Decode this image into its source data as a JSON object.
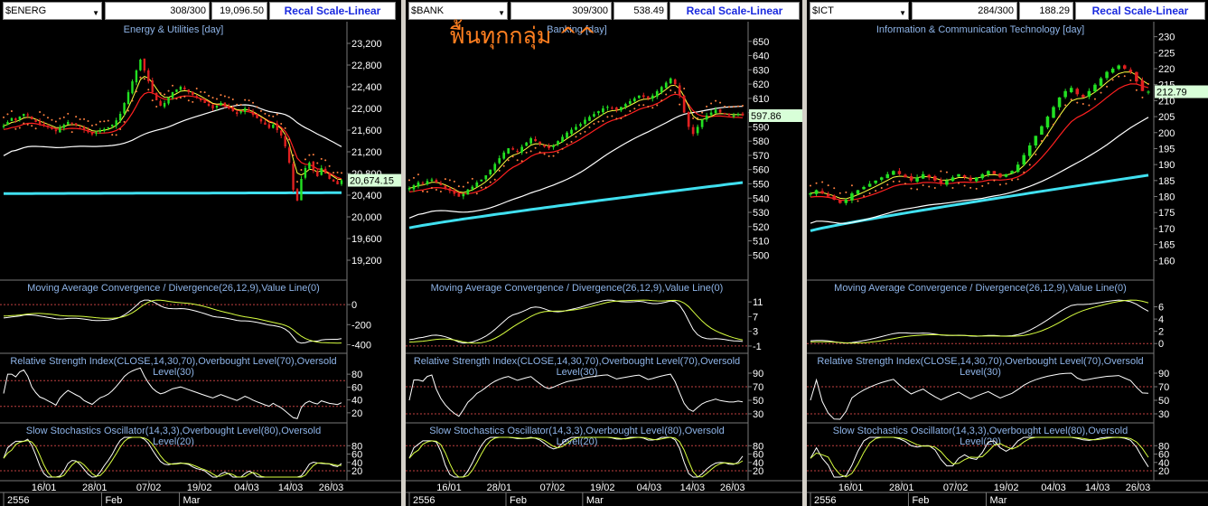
{
  "annotation": "ฟื้นทุกกลุ่ม ^^",
  "recal_label": "Recal Scale-Linear",
  "colors": {
    "bull": "#22e022",
    "bear": "#e02020",
    "ma_fast": "#ffff40",
    "ma_mid": "#ff2020",
    "ma_slow": "#ffffff",
    "ma_long": "#40e0f0",
    "sar": "#ff8040",
    "panel_bg": "#000000",
    "grid": "#777777",
    "title": "#8eb4e8",
    "level": "#c04040"
  },
  "panels": [
    {
      "symbol": "$ENERG",
      "count": "308/300",
      "value": "19,096.50",
      "main": {
        "title": "Energy & Utilities [day]",
        "min": 18900,
        "max": 23500,
        "ticks": [
          "23,200",
          "22,800",
          "22,400",
          "22,000",
          "21,600",
          "21,200",
          "20,800",
          "20,400",
          "20,000",
          "19,600",
          "19,200"
        ],
        "tick_values": [
          23200,
          22800,
          22400,
          22000,
          21600,
          21200,
          20800,
          20400,
          20000,
          19600,
          19200
        ],
        "last": "20,674.15",
        "last_value": 20674.15,
        "closes": [
          21680,
          21750,
          21820,
          21780,
          21850,
          21900,
          21870,
          21800,
          21750,
          21700,
          21680,
          21650,
          21620,
          21580,
          21650,
          21700,
          21750,
          21720,
          21690,
          21660,
          21600,
          21560,
          21520,
          21560,
          21600,
          21620,
          21650,
          21700,
          21780,
          21900,
          22100,
          22300,
          22500,
          22700,
          22900,
          22700,
          22500,
          22300,
          22150,
          22050,
          22100,
          22200,
          22300,
          22350,
          22400,
          22350,
          22300,
          22250,
          22200,
          22150,
          22100,
          22050,
          22000,
          22050,
          22100,
          22050,
          22000,
          21950,
          21900,
          21950,
          22000,
          21950,
          21880,
          21820,
          21760,
          21700,
          21640,
          21700,
          21600,
          21500,
          21300,
          21000,
          20500,
          20300,
          20700,
          20900,
          21000,
          20850,
          20750,
          20900,
          20800,
          20700,
          20650,
          20600,
          20674
        ]
      },
      "macd": {
        "title": "Moving Average Convergence / Divergence(26,12,9),Value Line(0)",
        "min": -450,
        "max": 100,
        "ticks": [
          "0",
          "-200",
          "-400"
        ],
        "tick_values": [
          0,
          -200,
          -400
        ],
        "levels": [
          0
        ]
      },
      "rsi": {
        "title": "Relative Strength Index(CLOSE,14,30,70),Overbought Level(70),Oversold Level(30)",
        "min": 10,
        "max": 90,
        "ticks": [
          "80",
          "60",
          "40",
          "20"
        ],
        "tick_values": [
          80,
          60,
          40,
          20
        ],
        "levels": [
          70,
          30
        ]
      },
      "sto": {
        "title": "Slow Stochastics Oscillator(14,3,3),Overbought Level(80),Oversold Level(20)",
        "min": 5,
        "max": 100,
        "ticks": [
          "80",
          "60",
          "40",
          "20"
        ],
        "tick_values": [
          80,
          60,
          40,
          20
        ],
        "levels": [
          80,
          20
        ]
      },
      "dates": [
        "16/01",
        "28/01",
        "07/02",
        "19/02",
        "04/03",
        "14/03",
        "26/03"
      ],
      "bottom": [
        "2556",
        "Feb",
        "Mar"
      ]
    },
    {
      "symbol": "$BANK",
      "count": "309/300",
      "value": "538.49",
      "main": {
        "title": "Banking [day]",
        "min": 485,
        "max": 660,
        "ticks": [
          "650",
          "640",
          "630",
          "620",
          "610",
          "600",
          "590",
          "580",
          "570",
          "560",
          "550",
          "540",
          "530",
          "520",
          "510",
          "500"
        ],
        "tick_values": [
          650,
          640,
          630,
          620,
          610,
          600,
          590,
          580,
          570,
          560,
          550,
          540,
          530,
          520,
          510,
          500
        ],
        "last": "597.86",
        "last_value": 597.86,
        "closes": [
          547,
          549,
          551,
          550,
          552,
          553,
          551,
          549,
          547,
          545,
          543,
          541,
          543,
          546,
          548,
          551,
          553,
          556,
          560,
          564,
          568,
          572,
          575,
          574,
          573,
          576,
          579,
          582,
          580,
          578,
          576,
          575,
          577,
          580,
          583,
          586,
          588,
          590,
          592,
          595,
          597,
          599,
          601,
          603,
          604,
          603,
          602,
          604,
          606,
          608,
          610,
          612,
          611,
          610,
          612,
          615,
          618,
          621,
          624,
          620,
          612,
          600,
          590,
          585,
          590,
          595,
          598,
          600,
          602,
          600,
          599,
          598,
          598,
          599,
          598
        ]
      },
      "macd": {
        "title": "Moving Average Convergence / Divergence(26,12,9),Value Line(0)",
        "min": -2,
        "max": 13,
        "ticks": [
          "11",
          "7",
          "3",
          "-1"
        ],
        "tick_values": [
          11,
          7,
          3,
          -1
        ],
        "levels": [
          -1
        ]
      },
      "rsi": {
        "title": "Relative Strength Index(CLOSE,14,30,70),Overbought Level(70),Oversold Level(30)",
        "min": 22,
        "max": 98,
        "ticks": [
          "90",
          "70",
          "50",
          "30"
        ],
        "tick_values": [
          90,
          70,
          50,
          30
        ],
        "levels": [
          70,
          30
        ]
      },
      "sto": {
        "title": "Slow Stochastics Oscillator(14,3,3),Overbought Level(80),Oversold Level(20)",
        "min": 5,
        "max": 100,
        "ticks": [
          "80",
          "60",
          "40",
          "20"
        ],
        "tick_values": [
          80,
          60,
          40,
          20
        ],
        "levels": [
          80,
          20
        ]
      },
      "dates": [
        "16/01",
        "28/01",
        "07/02",
        "19/02",
        "04/03",
        "14/03",
        "26/03"
      ],
      "bottom": [
        "2556",
        "Feb",
        "Mar"
      ]
    },
    {
      "symbol": "$ICT",
      "count": "284/300",
      "value": "188.29",
      "main": {
        "title": "Information & Communication Technology [day]",
        "min": 155,
        "max": 233,
        "ticks": [
          "230",
          "225",
          "220",
          "215",
          "210",
          "205",
          "200",
          "195",
          "190",
          "185",
          "180",
          "175",
          "170",
          "165",
          "160"
        ],
        "tick_values": [
          230,
          225,
          220,
          215,
          210,
          205,
          200,
          195,
          190,
          185,
          180,
          175,
          170,
          165,
          160
        ],
        "last": "212.79",
        "last_value": 212.79,
        "closes": [
          181,
          182,
          181,
          180,
          179,
          178,
          179,
          181,
          182,
          183,
          184,
          185,
          186,
          187,
          188,
          187,
          186,
          185,
          186,
          187,
          186,
          185,
          184,
          185,
          186,
          187,
          186,
          185,
          186,
          187,
          188,
          187,
          186,
          187,
          188,
          190,
          193,
          196,
          199,
          202,
          205,
          208,
          211,
          213,
          214,
          212,
          211,
          213,
          215,
          217,
          219,
          220,
          221,
          220,
          219,
          216,
          213,
          212.8
        ]
      },
      "macd": {
        "title": "Moving Average Convergence / Divergence(26,12,9),Value Line(0)",
        "min": -1,
        "max": 8,
        "ticks": [
          "6",
          "4",
          "2",
          "0"
        ],
        "tick_values": [
          6,
          4,
          2,
          0
        ],
        "levels": [
          0
        ]
      },
      "rsi": {
        "title": "Relative Strength Index(CLOSE,14,30,70),Overbought Level(70),Oversold Level(30)",
        "min": 22,
        "max": 98,
        "ticks": [
          "90",
          "70",
          "50",
          "30"
        ],
        "tick_values": [
          90,
          70,
          50,
          30
        ],
        "levels": [
          70,
          30
        ]
      },
      "sto": {
        "title": "Slow Stochastics Oscillator(14,3,3),Overbought Level(80),Oversold Level(20)",
        "min": 5,
        "max": 100,
        "ticks": [
          "80",
          "60",
          "40",
          "20"
        ],
        "tick_values": [
          80,
          60,
          40,
          20
        ],
        "levels": [
          80,
          20
        ]
      },
      "dates": [
        "16/01",
        "28/01",
        "07/02",
        "19/02",
        "04/03",
        "14/03",
        "26/03"
      ],
      "bottom": [
        "2556",
        "Feb",
        "Mar"
      ]
    }
  ]
}
